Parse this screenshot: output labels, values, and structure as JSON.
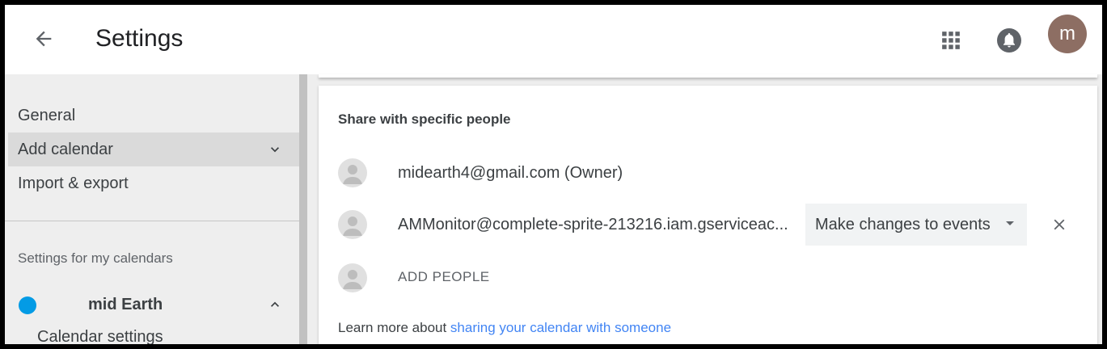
{
  "header": {
    "title": "Settings",
    "avatar_letter": "m",
    "avatar_color": "#8d6e63"
  },
  "sidebar": {
    "items": [
      {
        "label": "General"
      },
      {
        "label": "Add calendar"
      },
      {
        "label": "Import & export"
      }
    ],
    "section_label": "Settings for my calendars",
    "calendar": {
      "name": "mid Earth",
      "color": "#039be5",
      "sub_item": "Calendar settings"
    }
  },
  "share": {
    "title": "Share with specific people",
    "people": [
      {
        "email": "midearth4@gmail.com (Owner)"
      },
      {
        "email": "AMMonitor@complete-sprite-213216.iam.gserviceac...",
        "permission": "Make changes to events"
      }
    ],
    "add_people_label": "ADD PEOPLE",
    "learn_prefix": "Learn more about ",
    "learn_link": "sharing your calendar with someone"
  },
  "icons": {
    "back": "arrow-back-icon",
    "apps": "apps-grid-icon",
    "notifications": "bell-icon",
    "remove": "close-icon"
  }
}
